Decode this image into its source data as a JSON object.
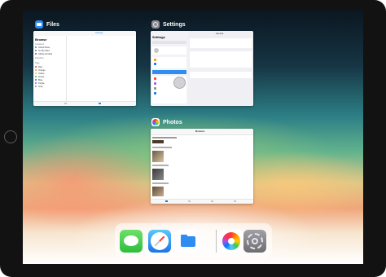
{
  "switcher": {
    "apps": [
      {
        "name": "Files",
        "icon": "files-icon",
        "color": "#2f8cf0"
      },
      {
        "name": "Settings",
        "icon": "settings-icon",
        "color": "#8e8e93"
      },
      {
        "name": "Photos",
        "icon": "photos-icon",
        "color": "#ffffff"
      }
    ]
  },
  "files_preview": {
    "top_label": "Settings",
    "sidebar_title": "Browse",
    "sections": [
      "Locations",
      "Favorites",
      "Tags"
    ],
    "locations": [
      "iCloud Drive",
      "On My iPad",
      "Adobe Acrobat"
    ],
    "tags": [
      "Red",
      "Orange",
      "Yellow",
      "Green",
      "Blue",
      "Purple",
      "Gray"
    ]
  },
  "settings_preview": {
    "title": "Settings",
    "detail_title": "General"
  },
  "photos_preview": {
    "title": "Moments"
  },
  "dock": {
    "apps": [
      {
        "name": "Messages",
        "icon": "messages-icon"
      },
      {
        "name": "Safari",
        "icon": "safari-icon"
      },
      {
        "name": "Files",
        "icon": "files-icon"
      },
      {
        "name": "Photos",
        "icon": "photos-icon"
      },
      {
        "name": "Settings",
        "icon": "settings-icon"
      }
    ]
  },
  "colors": {
    "accent": "#2f8cf0",
    "tag_colors": [
      "#ff3b30",
      "#ff9500",
      "#ffcc00",
      "#34c759",
      "#007aff",
      "#af52de",
      "#8e8e93"
    ]
  }
}
